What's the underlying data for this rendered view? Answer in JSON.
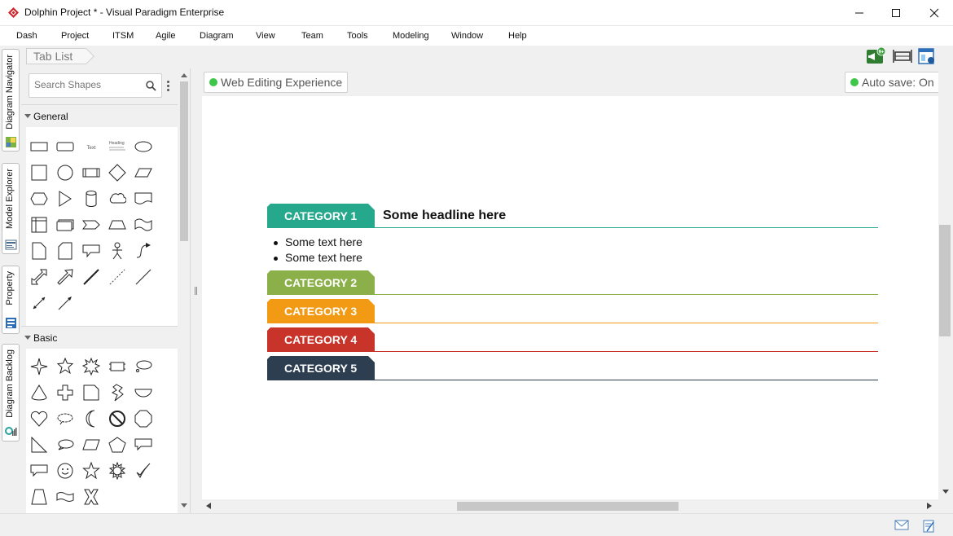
{
  "window": {
    "title": "Dolphin Project * - Visual Paradigm Enterprise",
    "app_icon": "visual-paradigm-logo-icon",
    "brand_color": "#d3232a"
  },
  "menu": [
    "Dash",
    "Project",
    "ITSM",
    "Agile",
    "Diagram",
    "View",
    "Team",
    "Tools",
    "Modeling",
    "Window",
    "Help"
  ],
  "left_tabs": [
    {
      "label": "Diagram Navigator",
      "icon": "diagram-navigator-icon"
    },
    {
      "label": "Model Explorer",
      "icon": "model-explorer-icon"
    },
    {
      "label": "Property",
      "icon": "property-icon"
    },
    {
      "label": "Diagram Backlog",
      "icon": "diagram-backlog-icon"
    }
  ],
  "toolbar": {
    "tab_list_label": "Tab List",
    "notification_badge": "9+",
    "icons": [
      "announcement-icon",
      "fit-diagram-icon",
      "layout-settings-icon"
    ]
  },
  "shape_panel": {
    "search_placeholder": "Search Shapes",
    "sections": [
      {
        "label": "General"
      },
      {
        "label": "Basic"
      }
    ],
    "general_text_shape": "Text",
    "general_heading_shape": "Heading"
  },
  "canvas": {
    "mode_label": "Web Editing Experience",
    "autosave_label": "Auto save: On",
    "status_color": "#3cc64a",
    "headline": "Some headline here",
    "bullets": [
      "Some text here",
      "Some text here"
    ],
    "categories": [
      {
        "label": "CATEGORY 1",
        "color": "#26a88d",
        "line": "#26a88d"
      },
      {
        "label": "CATEGORY 2",
        "color": "#8bb04a",
        "line": "#8bb04a"
      },
      {
        "label": "CATEGORY 3",
        "color": "#f39a14",
        "line": "#f39a14"
      },
      {
        "label": "CATEGORY 4",
        "color": "#c8332a",
        "line": "#c8332a"
      },
      {
        "label": "CATEGORY 5",
        "color": "#2c3e50",
        "line": "#2c3e50"
      }
    ]
  },
  "statusbar": {
    "icons": [
      "mail-icon",
      "notes-icon"
    ]
  }
}
